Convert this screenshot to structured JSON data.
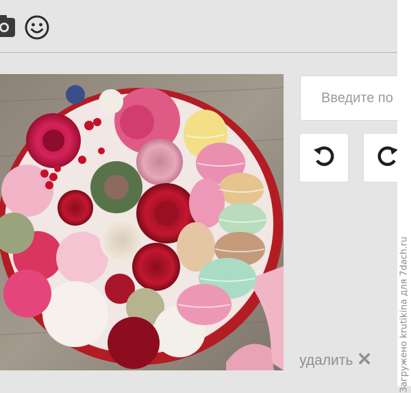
{
  "toolbar": {
    "icons": [
      "camera-icon",
      "smiley-icon"
    ]
  },
  "photo": {
    "subject": "flower-and-macaron-box"
  },
  "controls": {
    "search_placeholder": "Введите по",
    "undo_icon": "undo-icon",
    "redo_icon": "redo-icon",
    "delete_label": "удалить",
    "delete_icon": "close-icon"
  },
  "watermark": "Загружено krutikina для 7dach.ru",
  "colors": {
    "panel_bg": "#e5e5e5",
    "button_bg": "#ffffff",
    "icon_dark": "#222222",
    "muted_text": "#8f8f8f"
  }
}
